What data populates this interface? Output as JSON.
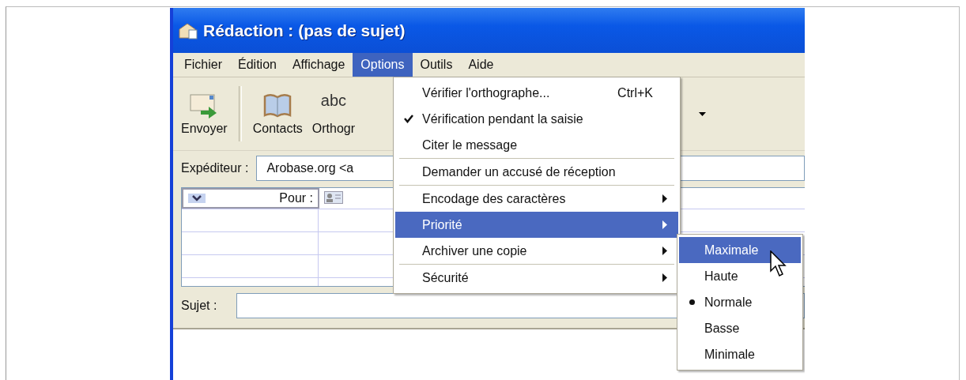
{
  "window": {
    "title": "Rédaction : (pas de sujet)"
  },
  "menubar": [
    {
      "label": "Fichier",
      "selected": false
    },
    {
      "label": "Édition",
      "selected": false
    },
    {
      "label": "Affichage",
      "selected": false
    },
    {
      "label": "Options",
      "selected": true
    },
    {
      "label": "Outils",
      "selected": false
    },
    {
      "label": "Aide",
      "selected": false
    }
  ],
  "toolbar": [
    {
      "kind": "send",
      "label": "Envoyer"
    },
    {
      "kind": "contacts",
      "label": "Contacts"
    },
    {
      "kind": "spelling",
      "label": "Orthogr",
      "icon_text": "abc"
    }
  ],
  "header": {
    "sender_label": "Expéditeur :",
    "sender_value": "Arobase.org <a",
    "recipient_type": "Pour :",
    "subject_label": "Sujet :"
  },
  "options_menu": [
    {
      "kind": "item",
      "label": "Vérifier l'orthographe...",
      "shortcut": "Ctrl+K",
      "checked": false,
      "submenu": false,
      "selected": false
    },
    {
      "kind": "item",
      "label": "Vérification pendant la saisie",
      "checked": true,
      "submenu": false,
      "selected": false
    },
    {
      "kind": "item",
      "label": "Citer le message",
      "checked": false,
      "submenu": false,
      "selected": false
    },
    {
      "kind": "separator"
    },
    {
      "kind": "item",
      "label": "Demander un accusé de réception",
      "checked": false,
      "submenu": false,
      "selected": false
    },
    {
      "kind": "separator"
    },
    {
      "kind": "item",
      "label": "Encodage des caractères",
      "checked": false,
      "submenu": true,
      "selected": false
    },
    {
      "kind": "item",
      "label": "Priorité",
      "checked": false,
      "submenu": true,
      "selected": true
    },
    {
      "kind": "item",
      "label": "Archiver une copie",
      "checked": false,
      "submenu": true,
      "selected": false
    },
    {
      "kind": "separator"
    },
    {
      "kind": "item",
      "label": "Sécurité",
      "checked": false,
      "submenu": true,
      "selected": false
    }
  ],
  "priority_submenu": [
    {
      "label": "Maximale",
      "checked": false,
      "selected": true
    },
    {
      "label": "Haute",
      "checked": false,
      "selected": false
    },
    {
      "label": "Normale",
      "checked": true,
      "selected": false
    },
    {
      "label": "Basse",
      "checked": false,
      "selected": false
    },
    {
      "label": "Minimale",
      "checked": false,
      "selected": false
    }
  ]
}
